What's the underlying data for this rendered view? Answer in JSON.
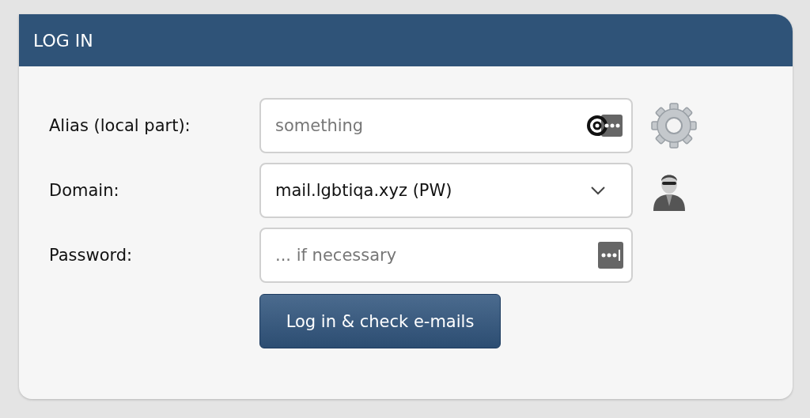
{
  "panel": {
    "title": "LOG IN"
  },
  "fields": [
    {
      "kind": "text",
      "label": "Alias (local part):",
      "placeholder": "something"
    },
    {
      "kind": "select",
      "label": "Domain:",
      "value": "mail.lgbtiqa.xyz (PW)"
    },
    {
      "kind": "password",
      "label": "Password:",
      "placeholder": "... if necessary"
    }
  ],
  "button": "Log in & check e-mails"
}
